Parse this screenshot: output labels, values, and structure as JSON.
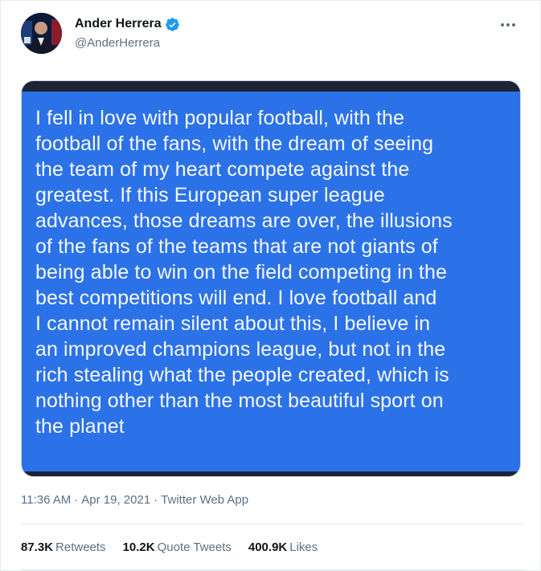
{
  "author": {
    "display_name": "Ander Herrera",
    "handle": "@AnderHerrera",
    "verified": true,
    "verified_color": "#1d9bf0"
  },
  "tweet": {
    "image_text": "I fell in love with popular football, with the\nfootball of the fans, with the dream of seeing\nthe team of my heart compete against the\ngreatest.  If this European super league\nadvances, those dreams are over, the illusions\nof the fans of the teams that are not giants of\nbeing able to win on the field competing in the\nbest competitions will end.  I love football and\nI cannot remain silent about this, I believe in\nan improved champions league, but not in the\nrich stealing what the people created, which is\nnothing other than the most beautiful sport on\nthe planet",
    "image_bg_color": "#2b72e8",
    "time": "11:36 AM",
    "date": "Apr 19, 2021",
    "source": "Twitter Web App"
  },
  "stats": {
    "retweets_count": "87.3K",
    "retweets_label": "Retweets",
    "quotes_count": "10.2K",
    "quotes_label": "Quote Tweets",
    "likes_count": "400.9K",
    "likes_label": "Likes"
  },
  "icons": {
    "more": "more-icon",
    "verified": "verified-badge-icon"
  }
}
